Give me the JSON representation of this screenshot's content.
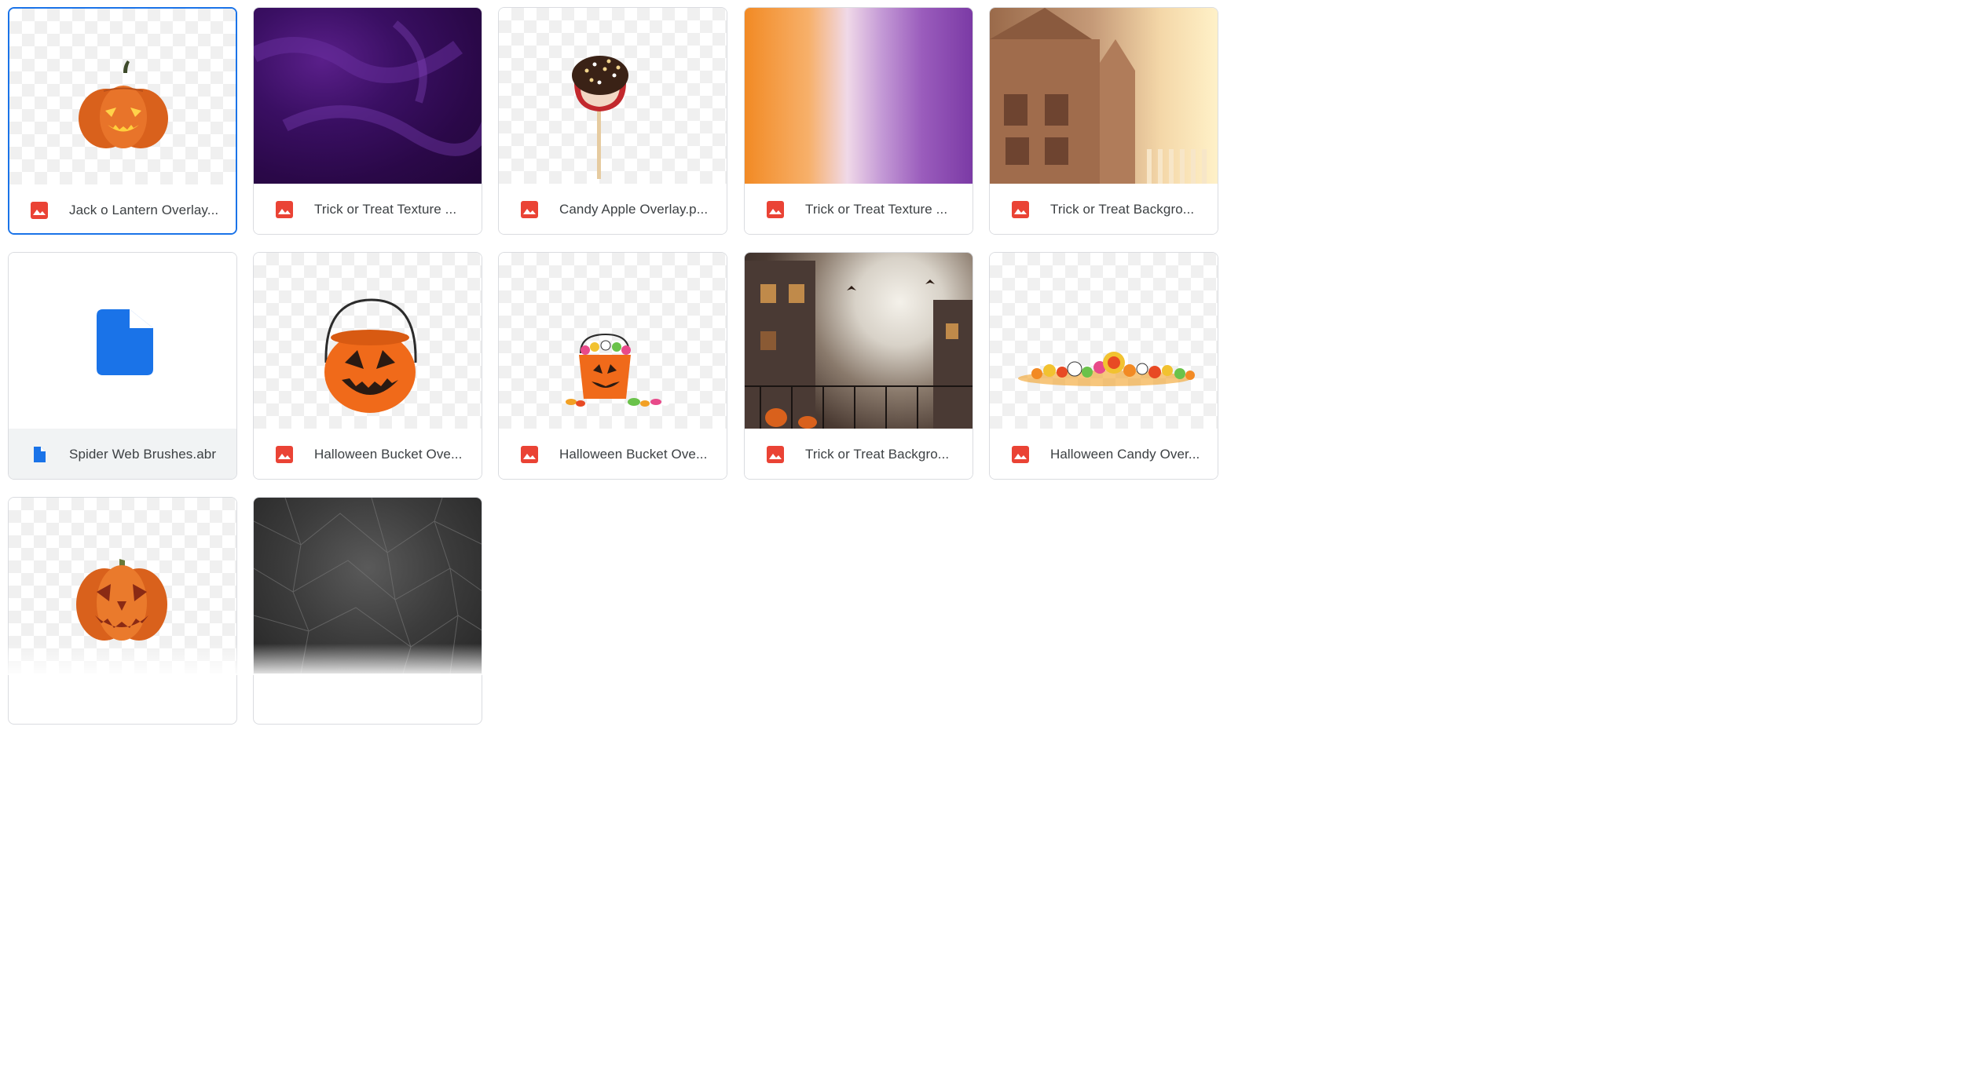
{
  "files": [
    {
      "name": "Jack o Lantern Overlay...",
      "type": "image",
      "selected": true
    },
    {
      "name": "Trick or Treat Texture ...",
      "type": "image"
    },
    {
      "name": "Candy Apple Overlay.p...",
      "type": "image"
    },
    {
      "name": "Trick or Treat Texture ...",
      "type": "image"
    },
    {
      "name": "Trick or Treat Backgro...",
      "type": "image"
    },
    {
      "name": "Spider Web Brushes.abr",
      "type": "document"
    },
    {
      "name": "Halloween Bucket Ove...",
      "type": "image"
    },
    {
      "name": "Halloween Bucket Ove...",
      "type": "image"
    },
    {
      "name": "Trick or Treat Backgro...",
      "type": "image"
    },
    {
      "name": "Halloween Candy Over...",
      "type": "image"
    },
    {
      "name": "",
      "type": "image"
    },
    {
      "name": "",
      "type": "image"
    }
  ],
  "colors": {
    "image_icon": "#ea4335",
    "doc_icon": "#1a73e8",
    "selection": "#1a73e8"
  },
  "icons": {
    "image": "image-file-icon",
    "document": "document-file-icon"
  }
}
